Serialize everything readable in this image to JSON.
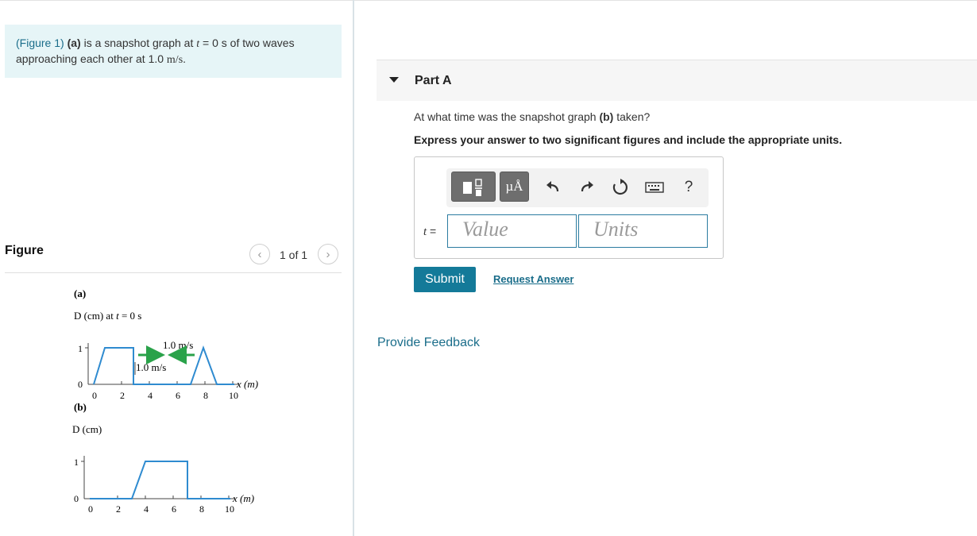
{
  "intro": {
    "figure_link": "(Figure 1)",
    "part_label": "(a)",
    "text_before_t": " is a snapshot graph at ",
    "t_var": "t",
    "text_after_t": " = 0 s of two waves approaching each other at 1.0 ",
    "speed_unit": "m/s",
    "end_period": "."
  },
  "figure": {
    "title": "Figure",
    "counter": "1 of 1",
    "prev_icon": "chevron-left",
    "next_icon": "chevron-right",
    "graph_a": {
      "label": "(a)",
      "y_label_prefix": "D (cm) at ",
      "y_label_t": "t",
      "y_label_suffix": " = 0 s",
      "x_axis_label": "x (m)",
      "x_ticks": [
        "0",
        "2",
        "4",
        "6",
        "8",
        "10"
      ],
      "y_ticks": [
        "0",
        "1"
      ],
      "speed_left": "1.0 m/s",
      "speed_right": "1.0 m/s",
      "arrow_color": "#2aa24a",
      "wave_color": "#2f8bd0"
    },
    "graph_b": {
      "label": "(b)",
      "y_label": "D (cm)",
      "x_axis_label": "x (m)",
      "x_ticks": [
        "0",
        "2",
        "4",
        "6",
        "8",
        "10"
      ],
      "y_ticks": [
        "0",
        "1"
      ],
      "wave_color": "#2f8bd0"
    }
  },
  "part_a": {
    "title": "Part A",
    "question_before": "At what time was the snapshot graph ",
    "question_bold": "(b)",
    "question_after": " taken?",
    "instruction": "Express your answer to two significant figures and include the appropriate units.",
    "toolbar": {
      "template_icon": "templates-icon",
      "units_label": "µÅ",
      "undo_icon": "undo-arrow",
      "redo_icon": "redo-arrow",
      "reset_icon": "reset-circle",
      "keyboard_icon": "keyboard",
      "help_label": "?"
    },
    "variable_label": "t =",
    "value_placeholder": "Value",
    "units_placeholder": "Units",
    "submit_label": "Submit",
    "request_answer_label": "Request Answer"
  },
  "feedback_label": "Provide Feedback",
  "colors": {
    "accent": "#147a99",
    "link": "#1a6d8a",
    "intro_bg": "#e6f5f7"
  }
}
